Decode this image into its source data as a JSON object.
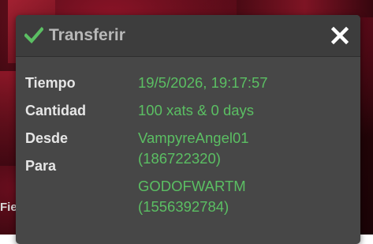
{
  "background": {
    "partial_text": "Fie"
  },
  "dialog": {
    "title": "Transferir",
    "icons": {
      "title_icon": "check-icon",
      "close_icon": "close-icon"
    },
    "colors": {
      "accent_green": "#5bbf63",
      "panel_bg": "#474747",
      "header_bg": "#3d3d3d"
    },
    "fields": {
      "time_label": "Tiempo",
      "time_value": "19/5/2026, 19:17:57",
      "amount_label": "Cantidad",
      "amount_value": "100 xats & 0 days",
      "from_label": "Desde",
      "from_name": "VampyreAngel01",
      "from_id": "(186722320)",
      "to_label": "Para",
      "to_name": "GODOFWARTM",
      "to_id": "(1556392784)"
    }
  }
}
